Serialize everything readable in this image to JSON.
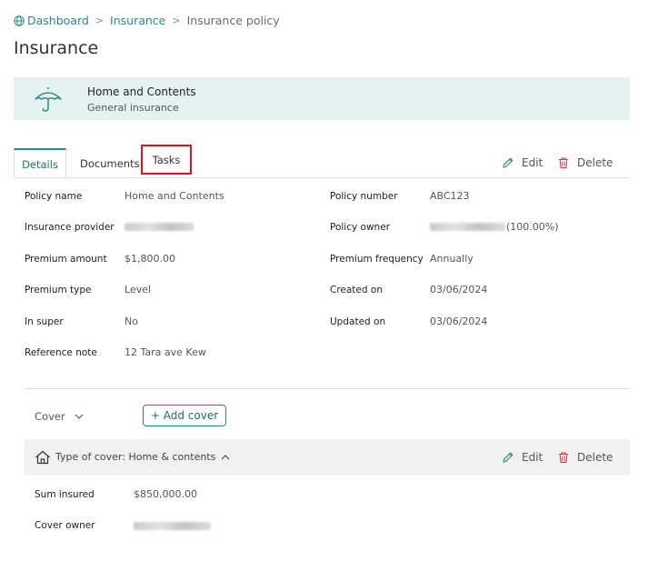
{
  "breadcrumb": {
    "items": [
      "Dashboard",
      "Insurance",
      "Insurance policy"
    ],
    "separator": ">"
  },
  "page": {
    "title": "Insurance"
  },
  "policy_banner": {
    "name": "Home and Contents",
    "category": "General insurance",
    "icon": "umbrella-icon"
  },
  "tabs": [
    "Details",
    "Documents",
    "Tasks"
  ],
  "actions": {
    "edit": "Edit",
    "delete": "Delete"
  },
  "details": {
    "left": [
      {
        "label": "Policy name",
        "value": "Home and Contents"
      },
      {
        "label": "Insurance provider",
        "value": ""
      },
      {
        "label": "Premium amount",
        "value": "$1,800.00"
      },
      {
        "label": "Premium type",
        "value": "Level"
      },
      {
        "label": "In super",
        "value": "No"
      },
      {
        "label": "Reference note",
        "value": "12 Tara ave Kew"
      }
    ],
    "right": [
      {
        "label": "Policy number",
        "value": "ABC123"
      },
      {
        "label": "Policy owner",
        "value": "(100.00%)"
      },
      {
        "label": "Premium frequency",
        "value": "Annually"
      },
      {
        "label": "Created on",
        "value": "03/06/2024"
      },
      {
        "label": "Updated on",
        "value": "03/06/2024"
      }
    ]
  },
  "cover": {
    "toggle_label": "Cover",
    "add_label": "+ Add cover",
    "type_label": "Type of cover: Home & contents",
    "fields": [
      {
        "label": "Sum insured",
        "value": "$850,000.00"
      },
      {
        "label": "Cover owner",
        "value": ""
      }
    ]
  },
  "colors": {
    "accent": "#2a8a83",
    "banner_bg": "#e4f3f2",
    "delete_red": "#d93a4a",
    "highlight": "#e0141a"
  }
}
